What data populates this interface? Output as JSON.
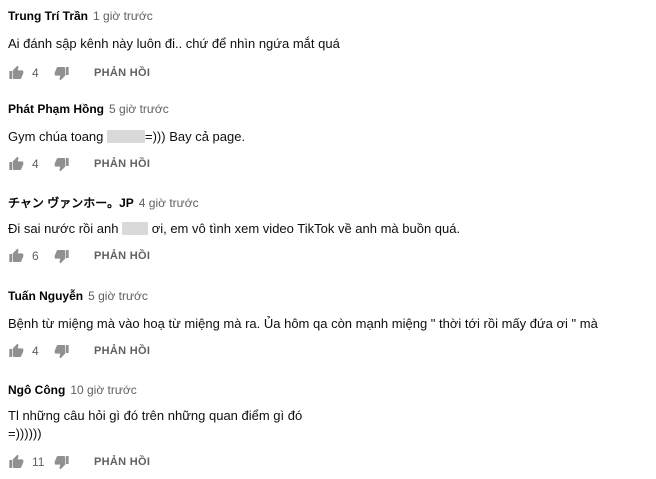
{
  "comments": [
    {
      "author": "Trung Trí Trần",
      "time": "1 giờ trước",
      "text_before": "Ai đánh sập kênh này luôn đi.. chứ để nhìn ngứa mắt quá",
      "text_after": "",
      "likes": "4",
      "reply_label": "PHẢN HỒI"
    },
    {
      "author": "Phát Phạm Hồng",
      "time": "5 giờ trước",
      "text_before": "Gym chúa toang",
      "text_after": "=))) Bay cả page.",
      "likes": "4",
      "reply_label": "PHẢN HỒI"
    },
    {
      "author": "チャン ヴァンホー。JP",
      "time": "4 giờ trước",
      "text_before": "Đi sai nước rồi anh",
      "text_after": "ơi, em vô tình xem video TikTok về anh mà buồn quá.",
      "likes": "6",
      "reply_label": "PHẢN HỒI"
    },
    {
      "author": "Tuấn Nguyễn",
      "time": "5 giờ trước",
      "text_before": "Bệnh từ miệng mà vào hoạ từ miệng mà ra. Ủa hôm qa còn mạnh miệng \" thời tới rồi mấy đứa ơi \" mà",
      "text_after": "",
      "likes": "4",
      "reply_label": "PHẢN HỒI"
    },
    {
      "author": "Ngô Công",
      "time": "10 giờ trước",
      "text_before": "Tl những câu hỏi gì đó trên những quan điểm gì đó",
      "text_line2": "=))))))",
      "likes": "11",
      "reply_label": "PHẢN HỒI"
    }
  ],
  "icons": {
    "like": "thumbs-up-icon",
    "dislike": "thumbs-down-icon"
  },
  "colors": {
    "meta": "#606060",
    "text": "#0f0f0f",
    "icon": "#909090"
  }
}
